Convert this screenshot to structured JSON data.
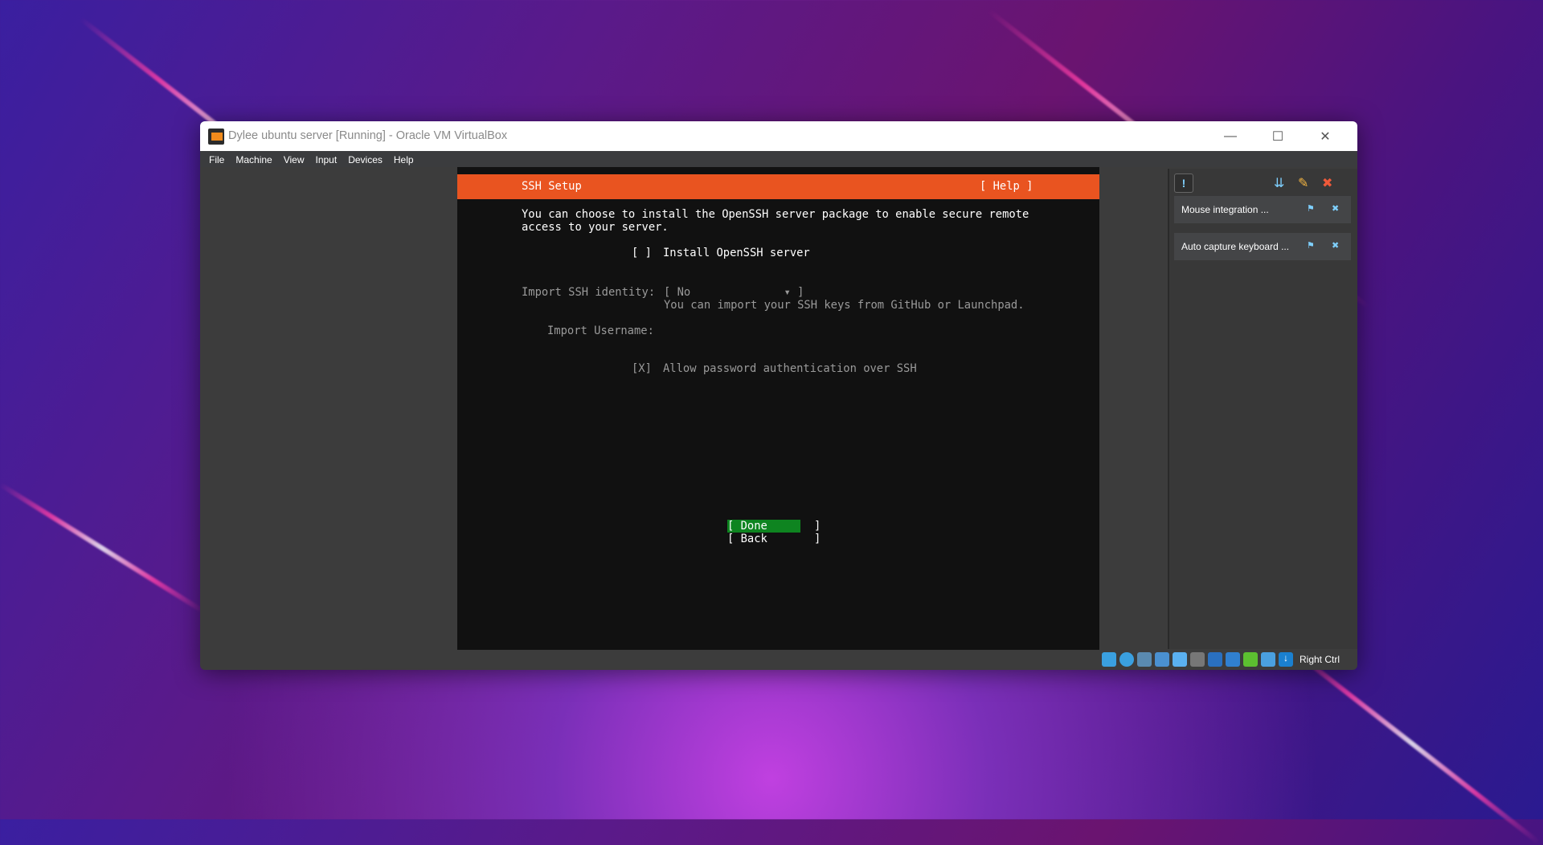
{
  "window": {
    "title": "Dylee ubuntu server [Running] - Oracle VM VirtualBox",
    "controls": [
      "—",
      "☐",
      "✕"
    ]
  },
  "menu": [
    "File",
    "Machine",
    "View",
    "Input",
    "Devices",
    "Help"
  ],
  "installer": {
    "header_title": "SSH Setup",
    "help": "[ Help ]",
    "intro_line1": "You can choose to install the OpenSSH server package to enable secure remote",
    "intro_line2": "access to your server.",
    "install_checkbox": "[ ]",
    "install_label": "Install OpenSSH server",
    "identity_label": "Import SSH identity:",
    "identity_value": "[ No              ▾ ]",
    "identity_hint": "You can import your SSH keys from GitHub or Launchpad.",
    "username_label": "Import Username:",
    "password_checkbox": "[X]",
    "password_label": "Allow password authentication over SSH",
    "done": "[ Done       ]",
    "back": "[ Back       ]"
  },
  "notifications": [
    {
      "text": "Mouse integration ..."
    },
    {
      "text": "Auto capture keyboard ..."
    }
  ],
  "status": {
    "host_key": "Right Ctrl"
  },
  "colors": {
    "accent": "#e95420",
    "done": "#0e8420"
  }
}
